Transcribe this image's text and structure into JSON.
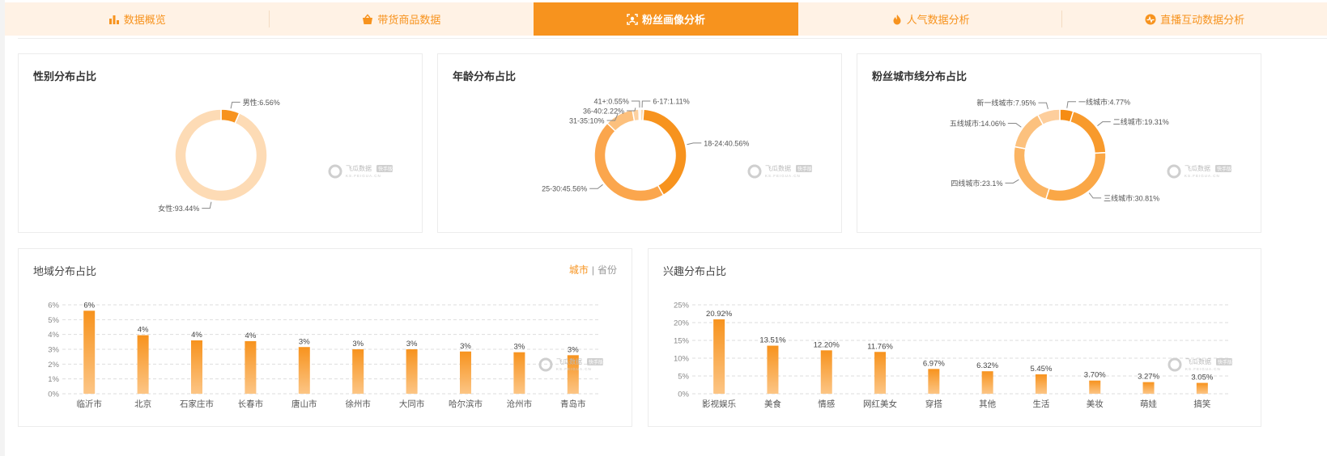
{
  "colors": {
    "accent": "#f7931e",
    "tab_bg": "#fff2e5",
    "bar_top": "#f7931e",
    "bar_bottom": "#fcc585",
    "leader": "#888888",
    "grid": "#dddddd"
  },
  "tabs": [
    {
      "label": "数据概览",
      "icon": "bar-chart-icon",
      "active": false
    },
    {
      "label": "带货商品数据",
      "icon": "basket-icon",
      "active": false
    },
    {
      "label": "粉丝画像分析",
      "icon": "face-scan-icon",
      "active": true
    },
    {
      "label": "人气数据分析",
      "icon": "fire-icon",
      "active": false
    },
    {
      "label": "直播互动数据分析",
      "icon": "pulse-icon",
      "active": false
    }
  ],
  "watermark": {
    "brand": "飞瓜数据",
    "badge": "快手版",
    "url": "KS.FEIGUA.CN"
  },
  "region_toggle": {
    "city": "城市",
    "separator": "|",
    "province": "省份"
  },
  "chart_data": [
    {
      "type": "pie",
      "donut": true,
      "title": "性别分布占比",
      "slices": [
        {
          "label": "男性:6.56%",
          "value": 6.56,
          "color": "#f7931e"
        },
        {
          "label": "女性:93.44%",
          "value": 93.44,
          "color": "#fddbb5"
        }
      ]
    },
    {
      "type": "pie",
      "donut": true,
      "title": "年龄分布占比",
      "slices": [
        {
          "label": "6-17:1.11%",
          "value": 1.11,
          "color": "#fdd9ae"
        },
        {
          "label": "18-24:40.56%",
          "value": 40.56,
          "color": "#f7931e"
        },
        {
          "label": "25-30:45.56%",
          "value": 45.56,
          "color": "#fba64d"
        },
        {
          "label": "31-35:10%",
          "value": 10,
          "color": "#fcc07d"
        },
        {
          "label": "36-40:2.22%",
          "value": 2.22,
          "color": "#fdd1a0"
        },
        {
          "label": "41+:0.55%",
          "value": 0.55,
          "color": "#fde3c6"
        }
      ]
    },
    {
      "type": "pie",
      "donut": true,
      "title": "粉丝城市线分布占比",
      "slices": [
        {
          "label": "一线城市:4.77%",
          "value": 4.77,
          "color": "#f68c13"
        },
        {
          "label": "二线城市:19.31%",
          "value": 19.31,
          "color": "#f89a2c"
        },
        {
          "label": "三线城市:30.81%",
          "value": 30.81,
          "color": "#faa746"
        },
        {
          "label": "四线城市:23.1%",
          "value": 23.1,
          "color": "#fbb462"
        },
        {
          "label": "五线城市:14.06%",
          "value": 14.06,
          "color": "#fcc17e"
        },
        {
          "label": "新一线城市:7.95%",
          "value": 7.95,
          "color": "#fdce9c"
        }
      ]
    },
    {
      "type": "bar",
      "title": "地域分布占比",
      "categories": [
        "临沂市",
        "北京",
        "石家庄市",
        "长春市",
        "唐山市",
        "徐州市",
        "大同市",
        "哈尔滨市",
        "沧州市",
        "青岛市"
      ],
      "values": [
        5.6,
        3.95,
        3.6,
        3.55,
        3.15,
        3.0,
        3.0,
        2.85,
        2.8,
        2.6
      ],
      "data_labels": [
        "6%",
        "4%",
        "4%",
        "4%",
        "3%",
        "3%",
        "3%",
        "3%",
        "3%",
        "3%"
      ],
      "yticks": [
        "0%",
        "1%",
        "2%",
        "3%",
        "4%",
        "5%",
        "6%"
      ],
      "ylim": [
        0,
        6
      ],
      "grid": true
    },
    {
      "type": "bar",
      "title": "兴趣分布占比",
      "categories": [
        "影视娱乐",
        "美食",
        "情感",
        "网红美女",
        "穿搭",
        "其他",
        "生活",
        "美妆",
        "萌娃",
        "搞笑"
      ],
      "values": [
        20.92,
        13.51,
        12.2,
        11.76,
        6.97,
        6.32,
        5.45,
        3.7,
        3.27,
        3.05
      ],
      "data_labels": [
        "20.92%",
        "13.51%",
        "12.20%",
        "11.76%",
        "6.97%",
        "6.32%",
        "5.45%",
        "3.70%",
        "3.27%",
        "3.05%"
      ],
      "yticks": [
        "0%",
        "5%",
        "10%",
        "15%",
        "20%",
        "25%"
      ],
      "ylim": [
        0,
        25
      ],
      "grid": true
    }
  ]
}
